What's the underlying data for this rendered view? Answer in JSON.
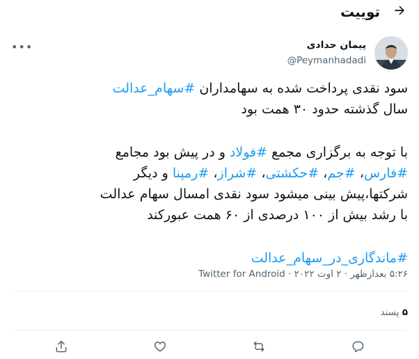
{
  "header": {
    "title": "توییت",
    "back_icon": "arrow-back-icon"
  },
  "author": {
    "name": "پیمان حدادی",
    "handle": "@Peymanhadadi",
    "avatar_icon": "avatar-photo"
  },
  "tweet": {
    "line1_text": "سود نقدی پرداخت شده به سهامداران ",
    "line1_tag": "#سهام_عدالت",
    "line2": "سال گذشته حدود ۳۰ همت بود",
    "line3_text": "با توجه به برگزاری مجمع ",
    "line3_tag": "#فولاد",
    "line3_rest": " و در پیش بود مجامع",
    "line4_tags": [
      "#فارس",
      "#جم",
      "#حکشتی",
      "#شراز",
      "#رمپنا"
    ],
    "line4_sep": "، ",
    "line4_rest": " و دیگر",
    "line5": "شرکتها،پیش بینی میشود سود نقدی امسال سهام عدالت",
    "line6": "با رشد بیش از ۱۰۰ درصدی از ۶۰ همت عبورکند",
    "final_tag": "#ماندگاری_در_سهام_عدالت"
  },
  "meta": {
    "time": "۵:۲۶ بعدازظهر",
    "separator": " · ",
    "date": "۲ اوت ۲۰۲۲",
    "source": "Twitter for Android"
  },
  "stats": {
    "likes_count": "۵",
    "likes_label": "پسند"
  },
  "actions": [
    "reply-icon",
    "retweet-icon",
    "like-icon",
    "share-icon"
  ]
}
